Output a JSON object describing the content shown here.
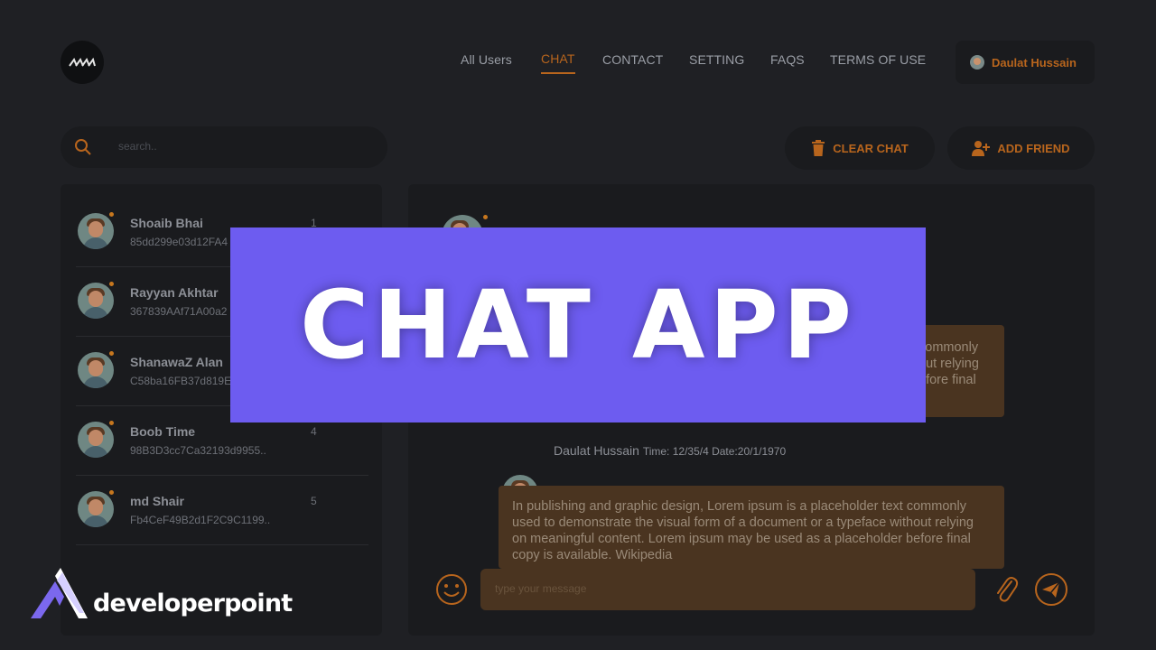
{
  "header": {
    "nav": [
      {
        "label": "All Users"
      },
      {
        "label": "CHAT"
      },
      {
        "label": "CONTACT"
      },
      {
        "label": "SETTING"
      },
      {
        "label": "FAQS"
      },
      {
        "label": "TERMS OF USE"
      }
    ],
    "active_nav": "CHAT",
    "current_user": "Daulat Hussain"
  },
  "search": {
    "placeholder": "search.."
  },
  "actions": {
    "clear_chat": "CLEAR CHAT",
    "add_friend": "ADD FRIEND"
  },
  "friends": [
    {
      "name": "Shoaib Bhai",
      "id": "85dd299e03d12FA4",
      "count": "1"
    },
    {
      "name": "Rayyan Akhtar",
      "id": "367839AAf71A00a2",
      "count": ""
    },
    {
      "name": "ShanawaZ Alan",
      "id": "C58ba16FB37d819E",
      "count": ""
    },
    {
      "name": "Boob Time",
      "id": "98B3D3cc7Ca32193d9955..",
      "count": "4"
    },
    {
      "name": "md Shair",
      "id": "Fb4CeF49B2d1F2C9C1199..",
      "count": "5"
    }
  ],
  "messages": [
    {
      "partial_lines": [
        "commonly",
        "out relying",
        "efore final"
      ]
    },
    {
      "sender": "Daulat Hussain",
      "time": "Time: 12/35/4 Date:20/1/1970",
      "text": "In publishing and graphic design, Lorem ipsum is a placeholder text commonly used to demonstrate the visual form of a document or a typeface without relying on meaningful content. Lorem ipsum may be used as a placeholder before final copy is available. Wikipedia"
    }
  ],
  "composer": {
    "placeholder": "type your message"
  },
  "banner": {
    "title": "CHAT APP"
  },
  "brand": {
    "name": "developerpoint"
  },
  "colors": {
    "accent": "#b8651d",
    "banner": "#6d5cf0",
    "background": "#1f2024",
    "bubble": "#4a3420"
  }
}
